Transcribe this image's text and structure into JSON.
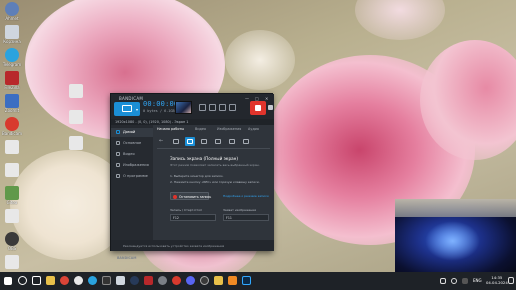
{
  "desktop": {
    "icons": [
      {
        "label": "Ahmet",
        "icon": "user-folder-icon",
        "color": "#5e7fb8"
      },
      {
        "label": "Корзина",
        "icon": "recycle-bin-icon",
        "color": "#cfd6de"
      },
      {
        "label": "Telegram",
        "icon": "telegram-icon",
        "color": "#2aa3df"
      },
      {
        "label": "FileZilla",
        "icon": "filezilla-icon",
        "color": "#b8282b"
      },
      {
        "label": "ZoomIt",
        "icon": "zoomit-icon",
        "color": "#3b6ec2"
      },
      {
        "label": "Bandicam",
        "icon": "bandicam-icon",
        "color": "#d83a2e"
      },
      {
        "label": "",
        "icon": "document-icon",
        "color": "#e8e8e8"
      },
      {
        "label": "",
        "icon": "document-icon",
        "color": "#e8e8e8"
      },
      {
        "label": "Gitea",
        "icon": "gitea-icon",
        "color": "#60994a"
      },
      {
        "label": "",
        "icon": "document-icon",
        "color": "#e8e8e8"
      },
      {
        "label": "OBS",
        "icon": "obs-icon",
        "color": "#3a3a3a"
      },
      {
        "label": "",
        "icon": "document-icon",
        "color": "#e8e8e8"
      },
      {
        "label": "Minecraft",
        "icon": "minecraft-icon",
        "color": "#4f8a2f"
      },
      {
        "label": "Яндекс",
        "icon": "yandex-icon",
        "color": "#e84a3a"
      },
      {
        "label": "",
        "icon": "document-icon",
        "color": "#e8e8e8"
      },
      {
        "label": "",
        "icon": "document-icon",
        "color": "#e8e8e8"
      },
      {
        "label": "Андрей",
        "icon": "folder-icon",
        "color": "#e8c04a"
      }
    ]
  },
  "bandicam": {
    "brand": "BANDICAM",
    "timer": "00:00:00",
    "size": "0 bytes / 6.1GB",
    "titlebar": "1920x1080 - (0, 0), (1920, 1080) - Экран 1",
    "window_controls": [
      "—",
      "□",
      "✕"
    ],
    "sidebar": [
      {
        "label": "Домой",
        "active": true
      },
      {
        "label": "Основное",
        "active": false
      },
      {
        "label": "Видео",
        "active": false
      },
      {
        "label": "Изображения",
        "active": false
      },
      {
        "label": "О программе",
        "active": false
      }
    ],
    "tabs": [
      "Начало работы",
      "Видео",
      "Изображения",
      "Аудио"
    ],
    "content": {
      "title": "Запись экрана (Полный экран)",
      "description": "Этот режим позволяет записать весь выбранный экран.",
      "steps": [
        "1. Выберите монитор для записи.",
        "2. Нажмите кнопку «REC» или горячую клавишу записи."
      ],
      "stop_button": "Остановить запись",
      "help_link": "Подробнее о режиме записи",
      "hotkey_record_label": "Запись / Старт-Стоп",
      "hotkey_record_value": "F12",
      "hotkey_screenshot_label": "Захват изображения",
      "hotkey_screenshot_value": "F11"
    },
    "sidebar_brand": "BANDICAM",
    "status": "Рекомендуется использовать устройство захвата изображения"
  },
  "taskbar": {
    "language": "ENG",
    "time": "14:35",
    "date": "04.04.2024"
  },
  "colors": {
    "accent": "#1b8fd6",
    "record": "#e0342c",
    "timer": "#31a6f5"
  }
}
